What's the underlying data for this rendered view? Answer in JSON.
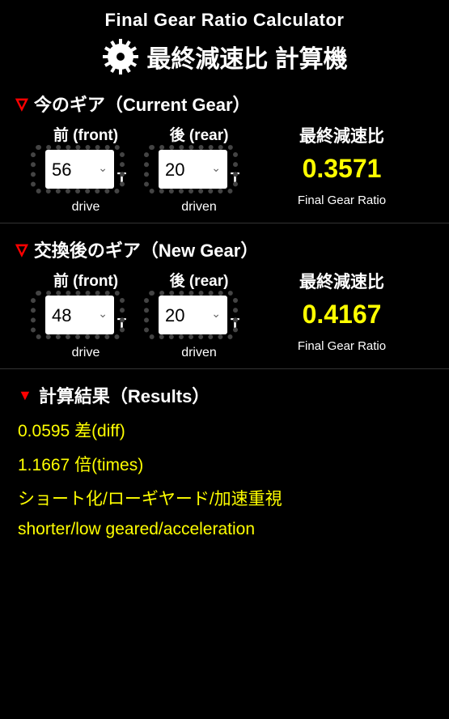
{
  "header": {
    "title_en": "Final Gear Ratio Calculator",
    "title_jp": "最終減速比 計算機"
  },
  "current": {
    "section_title": "今のギア（Current Gear）",
    "front_label": "前 (front)",
    "rear_label": "後 (rear)",
    "front_value": "56",
    "rear_value": "20",
    "t": "T",
    "drive_label": "drive",
    "driven_label": "driven",
    "ratio_label": "最終減速比",
    "ratio_value": "0.3571",
    "ratio_label_en": "Final Gear Ratio"
  },
  "new": {
    "section_title": "交換後のギア（New Gear）",
    "front_label": "前 (front)",
    "rear_label": "後 (rear)",
    "front_value": "48",
    "rear_value": "20",
    "t": "T",
    "drive_label": "drive",
    "driven_label": "driven",
    "ratio_label": "最終減速比",
    "ratio_value": "0.4167",
    "ratio_label_en": "Final Gear Ratio"
  },
  "results": {
    "section_title": "計算結果（Results）",
    "diff": "0.0595 差(diff)",
    "times": "1.1667 倍(times)",
    "desc_jp": "ショート化/ローギヤード/加速重視",
    "desc_en": "shorter/low geared/acceleration"
  }
}
